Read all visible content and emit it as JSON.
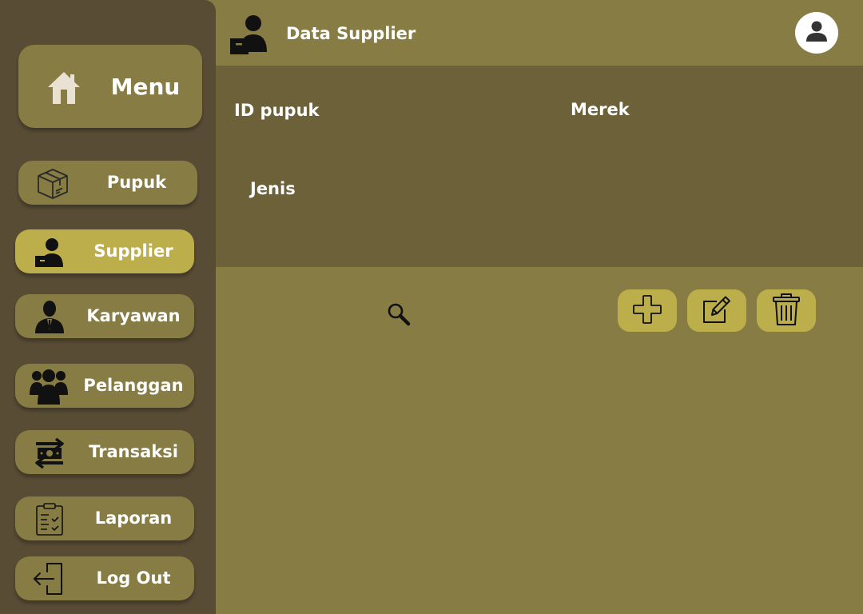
{
  "sidebar": {
    "menu": {
      "label": "Menu",
      "icon": "home-icon"
    },
    "items": [
      {
        "label": "Pupuk",
        "icon": "box-icon",
        "active": false
      },
      {
        "label": "Supplier",
        "icon": "supplier-icon",
        "active": true
      },
      {
        "label": "Karyawan",
        "icon": "employee-icon",
        "active": false
      },
      {
        "label": "Pelanggan",
        "icon": "customers-icon",
        "active": false
      },
      {
        "label": "Transaksi",
        "icon": "money-exchange-icon",
        "active": false
      },
      {
        "label": "Laporan",
        "icon": "clipboard-icon",
        "active": false
      },
      {
        "label": "Log Out",
        "icon": "logout-icon",
        "active": false
      }
    ]
  },
  "header": {
    "title": "Data Supplier",
    "icon": "supplier-icon",
    "avatar_icon": "user-icon"
  },
  "form": {
    "id_label": "ID pupuk",
    "merek_label": "Merek",
    "jenis_label": "Jenis"
  },
  "toolbar": {
    "search_icon": "search-icon",
    "add_icon": "plus-icon",
    "edit_icon": "edit-icon",
    "delete_icon": "trash-icon"
  },
  "colors": {
    "sidebar_bg": "#594c35",
    "main_bg": "#867c44",
    "panel_bg": "#6d6139",
    "accent": "#bcae4b"
  }
}
